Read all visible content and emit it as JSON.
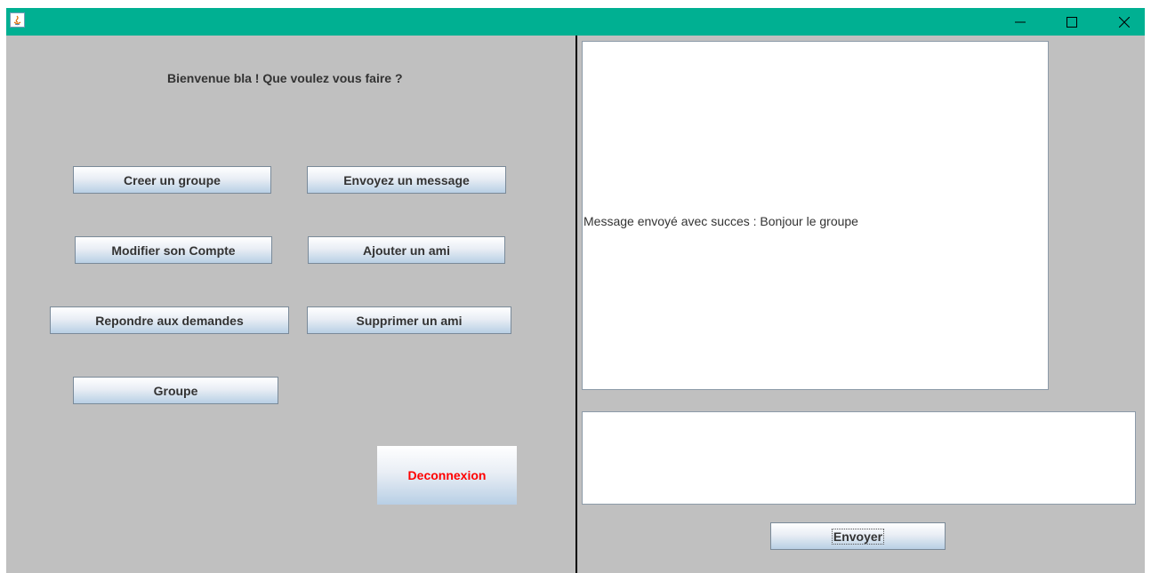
{
  "window": {
    "title": "",
    "controls": {
      "minimize": "minimize-icon",
      "maximize": "maximize-icon",
      "close": "close-icon"
    }
  },
  "colors": {
    "titlebar": "#00b092",
    "panel": "#c0c0c0",
    "danger_text": "#ff0000"
  },
  "left_panel": {
    "welcome": "Bienvenue bla ! Que voulez vous faire ?",
    "buttons": {
      "creer_groupe": "Creer un groupe",
      "envoyez_message": "Envoyez un message",
      "modifier_compte": "Modifier son Compte",
      "ajouter_ami": "Ajouter un ami",
      "repondre_demandes": "Repondre aux demandes",
      "supprimer_ami": "Supprimer un ami",
      "groupe": "Groupe",
      "deconnexion": "Deconnexion"
    }
  },
  "right_panel": {
    "message_display": "Message envoyé avec succes : Bonjour le groupe",
    "message_input_value": "",
    "send_button": "Envoyer"
  }
}
